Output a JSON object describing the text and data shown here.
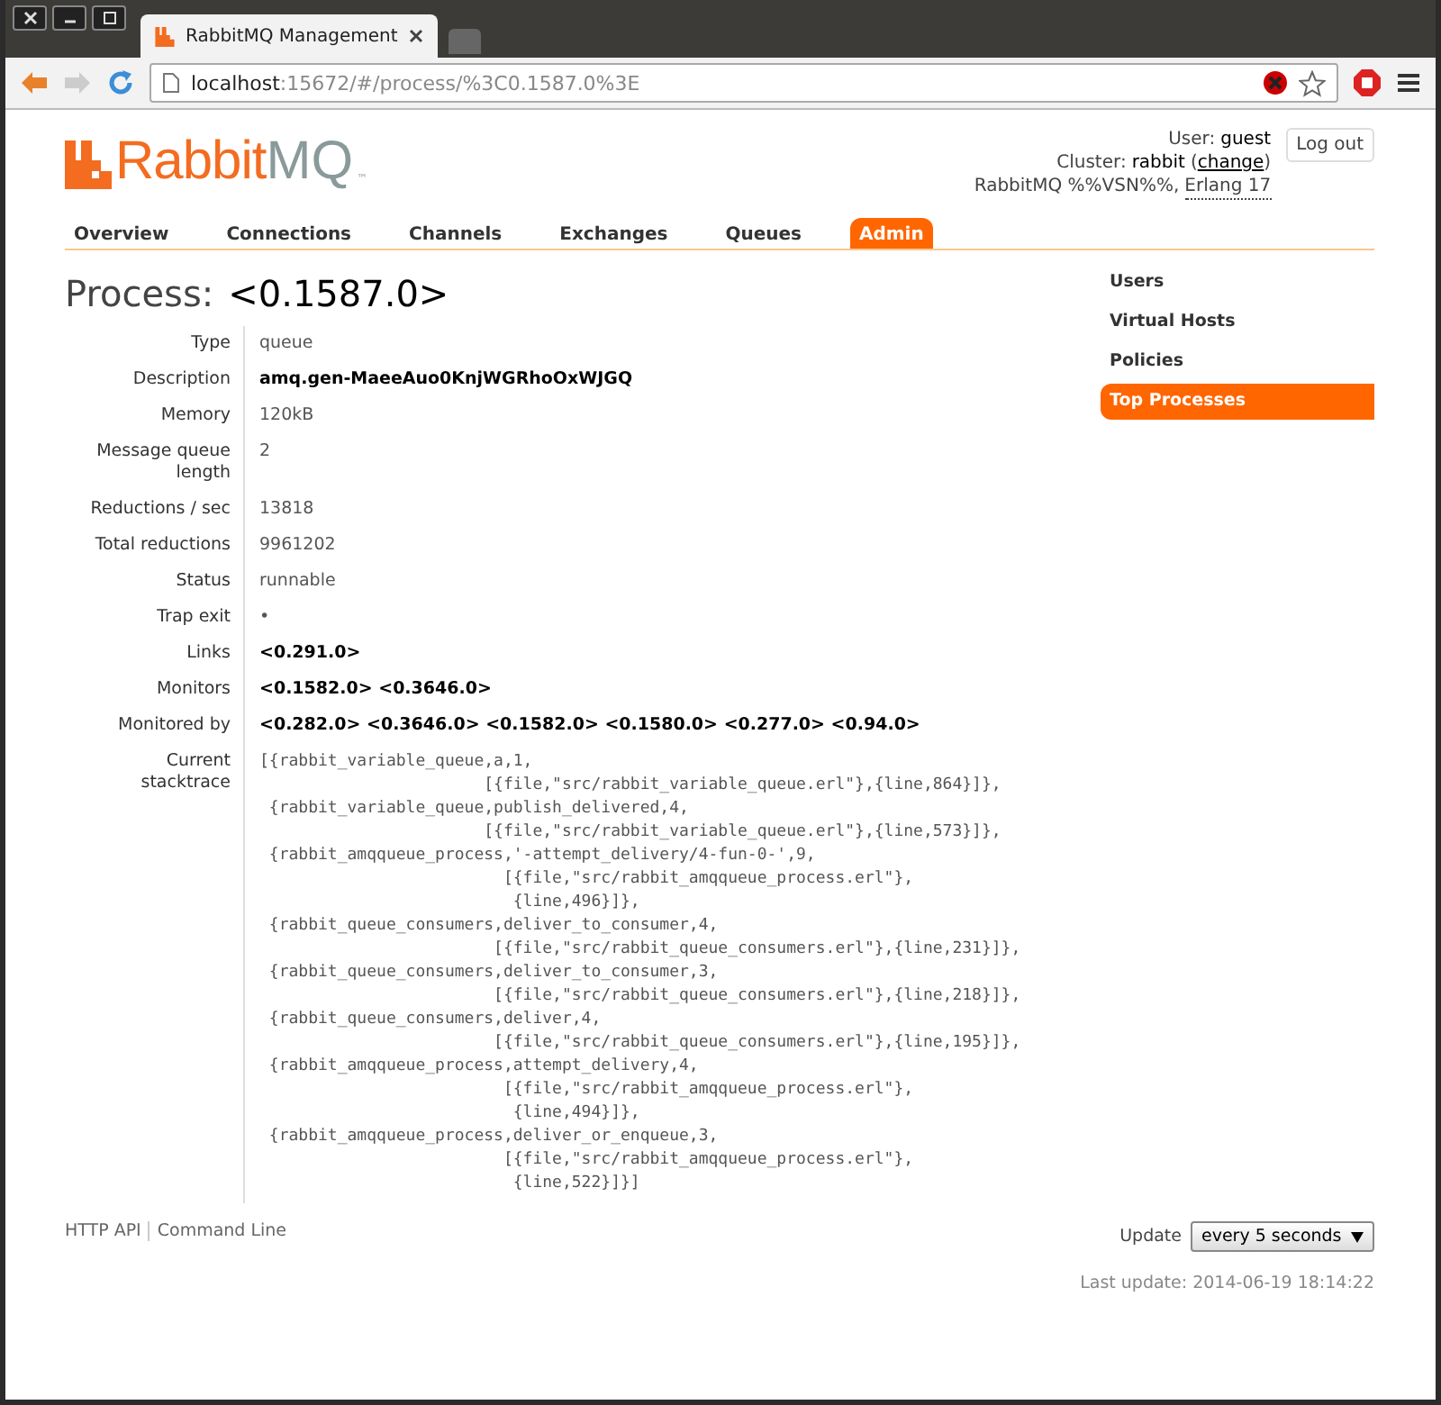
{
  "browser": {
    "tab_title": "RabbitMQ Management",
    "address_host": "localhost",
    "address_path": ":15672/#/process/%3C0.1587.0%3E",
    "back_enabled": true,
    "forward_enabled": false
  },
  "logo": {
    "rabbit": "Rabbit",
    "mq": "MQ",
    "tm": "™"
  },
  "header": {
    "user_label": "User:",
    "user": "guest",
    "cluster_label": "Cluster:",
    "cluster": "rabbit",
    "open_paren": "(",
    "change_link": "change",
    "close_paren": ")",
    "version": "RabbitMQ %%VSN%%,",
    "erlang": "Erlang 17",
    "logout": "Log out"
  },
  "tabs": [
    {
      "label": "Overview",
      "selected": false
    },
    {
      "label": "Connections",
      "selected": false
    },
    {
      "label": "Channels",
      "selected": false
    },
    {
      "label": "Exchanges",
      "selected": false
    },
    {
      "label": "Queues",
      "selected": false
    },
    {
      "label": "Admin",
      "selected": true
    }
  ],
  "title": "Process:",
  "pid": "<0.1587.0>",
  "rows": [
    {
      "label": "Type",
      "value": "queue",
      "kind": "plain"
    },
    {
      "label": "Description",
      "value": "amq.gen-MaeeAuo0KnjWGRhoOxWJGQ",
      "kind": "bold"
    },
    {
      "label": "Memory",
      "value": "120kB",
      "kind": "plain"
    },
    {
      "label": "Message queue length",
      "value": "2",
      "kind": "plain"
    },
    {
      "label": "Reductions / sec",
      "value": "13818",
      "kind": "plain"
    },
    {
      "label": "Total reductions",
      "value": "9961202",
      "kind": "plain"
    },
    {
      "label": "Status",
      "value": "runnable",
      "kind": "plain"
    },
    {
      "label": "Trap exit",
      "value": "•",
      "kind": "plain"
    },
    {
      "label": "Links",
      "value": "<0.291.0>",
      "kind": "bold"
    },
    {
      "label": "Monitors",
      "value": "<0.1582.0> <0.3646.0>",
      "kind": "bold"
    },
    {
      "label": "Monitored by",
      "value": "<0.282.0> <0.3646.0> <0.1582.0> <0.1580.0> <0.277.0> <0.94.0>",
      "kind": "bold"
    },
    {
      "label": "Current stacktrace",
      "value": "[{rabbit_variable_queue,a,1,\n                       [{file,\"src/rabbit_variable_queue.erl\"},{line,864}]},\n {rabbit_variable_queue,publish_delivered,4,\n                       [{file,\"src/rabbit_variable_queue.erl\"},{line,573}]},\n {rabbit_amqqueue_process,'-attempt_delivery/4-fun-0-',9,\n                         [{file,\"src/rabbit_amqqueue_process.erl\"},\n                          {line,496}]},\n {rabbit_queue_consumers,deliver_to_consumer,4,\n                        [{file,\"src/rabbit_queue_consumers.erl\"},{line,231}]},\n {rabbit_queue_consumers,deliver_to_consumer,3,\n                        [{file,\"src/rabbit_queue_consumers.erl\"},{line,218}]},\n {rabbit_queue_consumers,deliver,4,\n                        [{file,\"src/rabbit_queue_consumers.erl\"},{line,195}]},\n {rabbit_amqqueue_process,attempt_delivery,4,\n                         [{file,\"src/rabbit_amqqueue_process.erl\"},\n                          {line,494}]},\n {rabbit_amqqueue_process,deliver_or_enqueue,3,\n                         [{file,\"src/rabbit_amqqueue_process.erl\"},\n                          {line,522}]}]",
      "kind": "code"
    }
  ],
  "sidebar": [
    {
      "label": "Users",
      "selected": false
    },
    {
      "label": "Virtual Hosts",
      "selected": false
    },
    {
      "label": "Policies",
      "selected": false
    },
    {
      "label": "Top Processes",
      "selected": true
    }
  ],
  "footer": {
    "links": [
      "HTTP API",
      "Command Line"
    ],
    "update_label": "Update",
    "update_value": "every 5 seconds",
    "last_update": "Last update: 2014-06-19 18:14:22"
  }
}
